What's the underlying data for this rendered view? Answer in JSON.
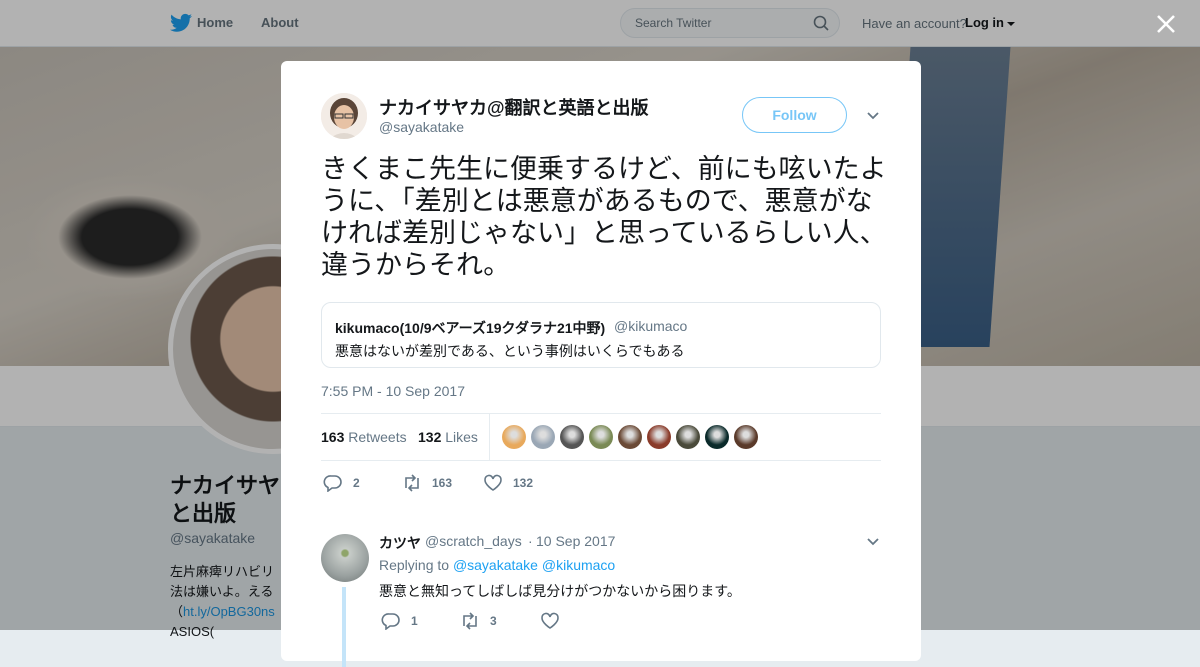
{
  "nav": {
    "home_label": "Home",
    "about_label": "About",
    "search_placeholder": "Search Twitter",
    "have_account": "Have an account?",
    "login_label": "Log in"
  },
  "background_profile": {
    "name": "ナカイサヤ",
    "name_line2": "と出版",
    "handle": "@sayakatake",
    "bio_line1": "左片麻痺リハビリ",
    "bio_line2": "法は嫌いよ。える",
    "bio_line3_prefix": "（",
    "bio_link": "ht.ly/OpBG30ns",
    "bio_line4": "ASIOS("
  },
  "tweet": {
    "author_name": "ナカイサヤカ@翻訳と英語と出版",
    "author_handle": "@sayakatake",
    "follow_label": "Follow",
    "text": "きくまこ先生に便乗するけど、前にも呟いたように、「差別とは悪意があるもので、悪意がなければ差別じゃない」と思っているらしい人、違うからそれ。",
    "quote": {
      "name": "kikumaco(10/9ベアーズ19クダラナ21中野)",
      "handle": "@kikumaco",
      "text": "悪意はないが差別である、という事例はいくらでもある"
    },
    "time": "7:55 PM - 10 Sep 2017",
    "retweets_count": "163",
    "retweets_label": "Retweets",
    "likes_count": "132",
    "likes_label": "Likes",
    "liker_colors": [
      "#e8a95c",
      "#9aa7b5",
      "#555555",
      "#7a8a55",
      "#6b4a36",
      "#8a3b2a",
      "#4a4a3a",
      "#0a2a2a",
      "#5a3a2a"
    ],
    "actions": {
      "replies": "2",
      "retweets": "163",
      "likes": "132"
    }
  },
  "reply": {
    "name": "カツヤ",
    "handle": "@scratch_days",
    "separator": "·",
    "date": "10 Sep 2017",
    "replying_prefix": "Replying to",
    "mention1": "@sayakatake",
    "mention2": "@kikumaco",
    "text": "悪意と無知ってしばしば見分けがつかないから困ります。",
    "actions": {
      "replies": "1",
      "retweets": "3",
      "likes": ""
    }
  },
  "colors": {
    "accent": "#1da1f2",
    "text": "#14171a",
    "muted": "#657786"
  }
}
